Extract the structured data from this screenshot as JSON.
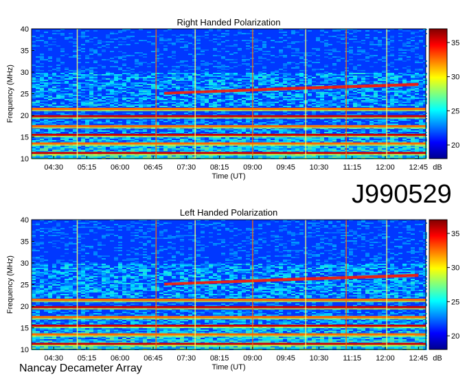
{
  "observation_id": "J990529",
  "instrument": "Nancay Decameter Array",
  "chart_data": [
    {
      "type": "heatmap",
      "title": "Right Handed Polarization",
      "xlabel": "Time (UT)",
      "ylabel": "Frequency (MHz)",
      "x_ticks": [
        "04:30",
        "05:15",
        "06:00",
        "06:45",
        "07:30",
        "08:15",
        "09:00",
        "09:45",
        "10:30",
        "11:15",
        "12:00",
        "12:45"
      ],
      "y_ticks": [
        10,
        15,
        20,
        25,
        30,
        35,
        40
      ],
      "ylim": [
        10,
        40
      ],
      "colorbar": {
        "label": "dB",
        "ticks": [
          20,
          25,
          30,
          35
        ],
        "range": [
          18,
          37
        ]
      },
      "vertical_lines": [
        "05:02",
        "06:49",
        "07:42",
        "09:00",
        "10:12",
        "11:07",
        "12:02"
      ],
      "strong_bands_mhz": [
        11.3,
        13.5,
        15.5,
        17.5,
        19.8,
        21.5
      ]
    },
    {
      "type": "heatmap",
      "title": "Left Handed Polarization",
      "xlabel": "Time (UT)",
      "ylabel": "Frequency (MHz)",
      "x_ticks": [
        "04:30",
        "05:15",
        "06:00",
        "06:45",
        "07:30",
        "08:15",
        "09:00",
        "09:45",
        "10:30",
        "11:15",
        "12:00",
        "12:45"
      ],
      "y_ticks": [
        10,
        15,
        20,
        25,
        30,
        35,
        40
      ],
      "ylim": [
        10,
        40
      ],
      "colorbar": {
        "label": "dB",
        "ticks": [
          20,
          25,
          30,
          35
        ],
        "range": [
          18,
          37
        ]
      },
      "vertical_lines": [
        "05:02",
        "06:49",
        "07:42",
        "09:00",
        "10:12",
        "11:07",
        "12:02"
      ],
      "strong_bands_mhz": [
        11.3,
        13.5,
        15.5,
        17.5,
        19.8,
        21.5
      ]
    }
  ]
}
